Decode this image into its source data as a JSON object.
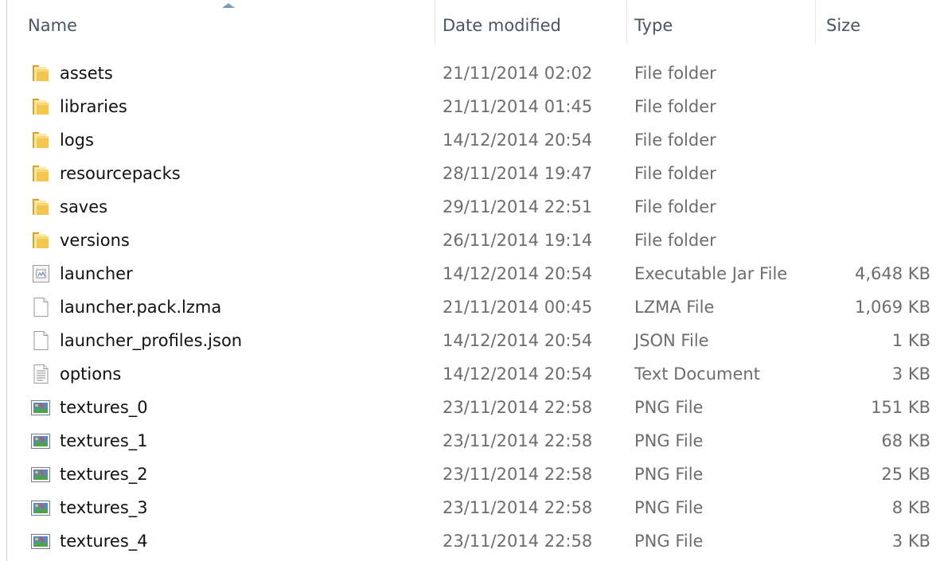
{
  "columns": {
    "name": "Name",
    "date": "Date modified",
    "type": "Type",
    "size": "Size"
  },
  "sort": {
    "column": "name",
    "direction": "ascending"
  },
  "files": [
    {
      "name": "assets",
      "date": "21/11/2014 02:02",
      "type": "File folder",
      "size": "",
      "icon": "folder-icon"
    },
    {
      "name": "libraries",
      "date": "21/11/2014 01:45",
      "type": "File folder",
      "size": "",
      "icon": "folder-icon"
    },
    {
      "name": "logs",
      "date": "14/12/2014 20:54",
      "type": "File folder",
      "size": "",
      "icon": "folder-icon"
    },
    {
      "name": "resourcepacks",
      "date": "28/11/2014 19:47",
      "type": "File folder",
      "size": "",
      "icon": "folder-icon"
    },
    {
      "name": "saves",
      "date": "29/11/2014 22:51",
      "type": "File folder",
      "size": "",
      "icon": "folder-icon"
    },
    {
      "name": "versions",
      "date": "26/11/2014 19:14",
      "type": "File folder",
      "size": "",
      "icon": "folder-icon"
    },
    {
      "name": "launcher",
      "date": "14/12/2014 20:54",
      "type": "Executable Jar File",
      "size": "4,648 KB",
      "icon": "jar-file-icon"
    },
    {
      "name": "launcher.pack.lzma",
      "date": "21/11/2014 00:45",
      "type": "LZMA File",
      "size": "1,069 KB",
      "icon": "blank-file-icon"
    },
    {
      "name": "launcher_profiles.json",
      "date": "14/12/2014 20:54",
      "type": "JSON File",
      "size": "1 KB",
      "icon": "blank-file-icon"
    },
    {
      "name": "options",
      "date": "14/12/2014 20:54",
      "type": "Text Document",
      "size": "3 KB",
      "icon": "text-file-icon"
    },
    {
      "name": "textures_0",
      "date": "23/11/2014 22:58",
      "type": "PNG File",
      "size": "151 KB",
      "icon": "image-file-icon"
    },
    {
      "name": "textures_1",
      "date": "23/11/2014 22:58",
      "type": "PNG File",
      "size": "68 KB",
      "icon": "image-file-icon"
    },
    {
      "name": "textures_2",
      "date": "23/11/2014 22:58",
      "type": "PNG File",
      "size": "25 KB",
      "icon": "image-file-icon"
    },
    {
      "name": "textures_3",
      "date": "23/11/2014 22:58",
      "type": "PNG File",
      "size": "8 KB",
      "icon": "image-file-icon"
    },
    {
      "name": "textures_4",
      "date": "23/11/2014 22:58",
      "type": "PNG File",
      "size": "3 KB",
      "icon": "image-file-icon"
    }
  ]
}
